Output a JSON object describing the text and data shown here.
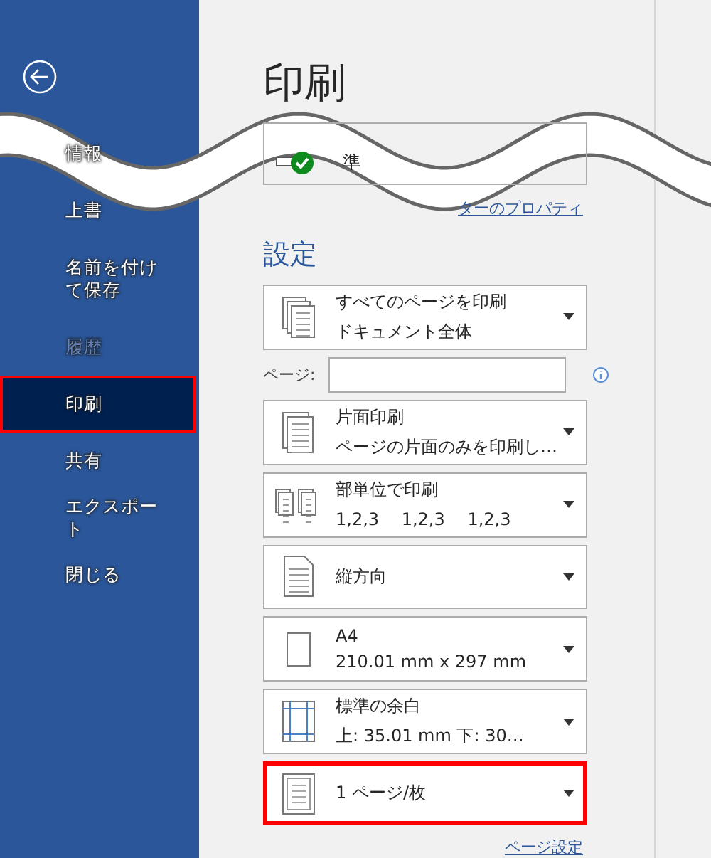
{
  "sidebar": {
    "items": [
      {
        "label": "情報",
        "selected": false,
        "disabled": false
      },
      {
        "label": "上書",
        "selected": false,
        "disabled": false
      },
      {
        "label": "名前を付けて保存",
        "selected": false,
        "disabled": false
      },
      {
        "label": "履歴",
        "selected": false,
        "disabled": true
      },
      {
        "label": "印刷",
        "selected": true,
        "disabled": false,
        "highlighted": true
      },
      {
        "label": "共有",
        "selected": false,
        "disabled": false
      },
      {
        "label": "エクスポート",
        "selected": false,
        "disabled": false
      },
      {
        "label": "閉じる",
        "selected": false,
        "disabled": false
      }
    ]
  },
  "title": "印刷",
  "printer": {
    "status": "準"
  },
  "printer_link": "ターのプロパティ",
  "settings_heading": "設定",
  "pages_field": {
    "label": "ページ:"
  },
  "settings": [
    {
      "kind": "pages",
      "title": "すべてのページを印刷",
      "subtitle": "ドキュメント全体",
      "highlighted": false
    },
    {
      "kind": "sides",
      "title": "片面印刷",
      "subtitle": "ページの片面のみを印刷し…",
      "highlighted": false
    },
    {
      "kind": "collate",
      "title": "部単位で印刷",
      "subtitle": "1,2,3　 1,2,3　 1,2,3",
      "highlighted": false
    },
    {
      "kind": "orientation",
      "title": "縦方向",
      "highlighted": false
    },
    {
      "kind": "paper",
      "title": "A4",
      "subtitle": "210.01 mm x 297 mm",
      "highlighted": false
    },
    {
      "kind": "margins",
      "title": "標準の余白",
      "subtitle": "上: 35.01 mm 下: 30…",
      "highlighted": false
    },
    {
      "kind": "persheet",
      "title": "1 ページ/枚",
      "highlighted": true
    }
  ],
  "page_setup_link": "ページ設定"
}
